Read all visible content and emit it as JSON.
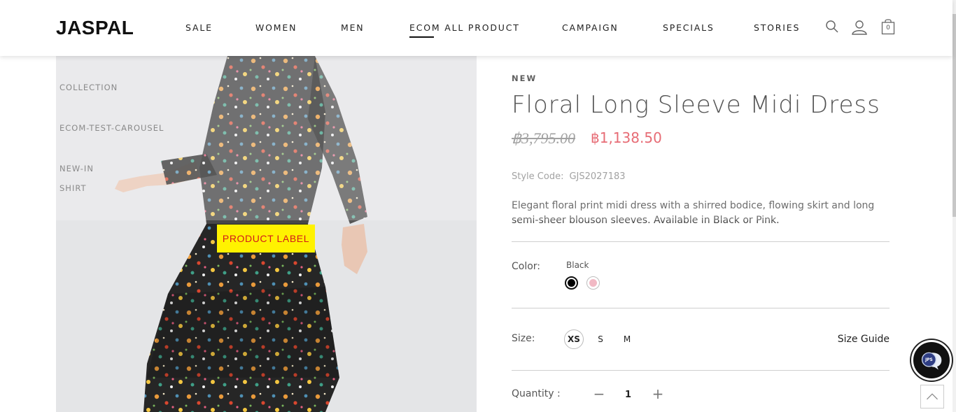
{
  "header": {
    "logo": "JASPAL",
    "nav": [
      "SALE",
      "WOMEN",
      "MEN",
      "ECOM ALL PRODUCT",
      "CAMPAIGN",
      "SPECIALS",
      "STORIES"
    ],
    "active_nav": "ECOM ALL PRODUCT",
    "cart_count": "0",
    "icons": [
      "search-icon",
      "user-icon",
      "shopping-bag-icon"
    ]
  },
  "gallery": {
    "side_links": [
      "COLLECTION",
      "ECOM-TEST-CAROUSEL",
      "NEW-IN",
      "SHIRT"
    ],
    "product_label": "PRODUCT LABEL",
    "background_color": "#e4e5e7"
  },
  "product": {
    "badge": "NEW",
    "title": "Floral Long Sleeve Midi Dress",
    "price_original": "฿3,795.00",
    "price_sale": "฿1,138.50",
    "style_code_label": "Style Code:",
    "style_code": "GJS2027183",
    "description": "Elegant floral print midi dress with a shirred bodice, flowing skirt and long semi-sheer blouson sleeves. Available in Black or Pink.",
    "color_label": "Color:",
    "selected_color": "Black",
    "colors": [
      "#000000",
      "#f1b9c4"
    ],
    "size_label": "Size:",
    "sizes": [
      "XS",
      "S",
      "M"
    ],
    "selected_size": "XS",
    "size_guide": "Size Guide",
    "quantity_label": "Quantity :",
    "quantity": "1",
    "quantity_minus": "−",
    "quantity_plus": "+"
  },
  "widgets": {
    "chat_badge": "JPS",
    "sale_color": "#e0434f",
    "label_bg": "#fff200",
    "label_text_color": "#d11a1a"
  }
}
